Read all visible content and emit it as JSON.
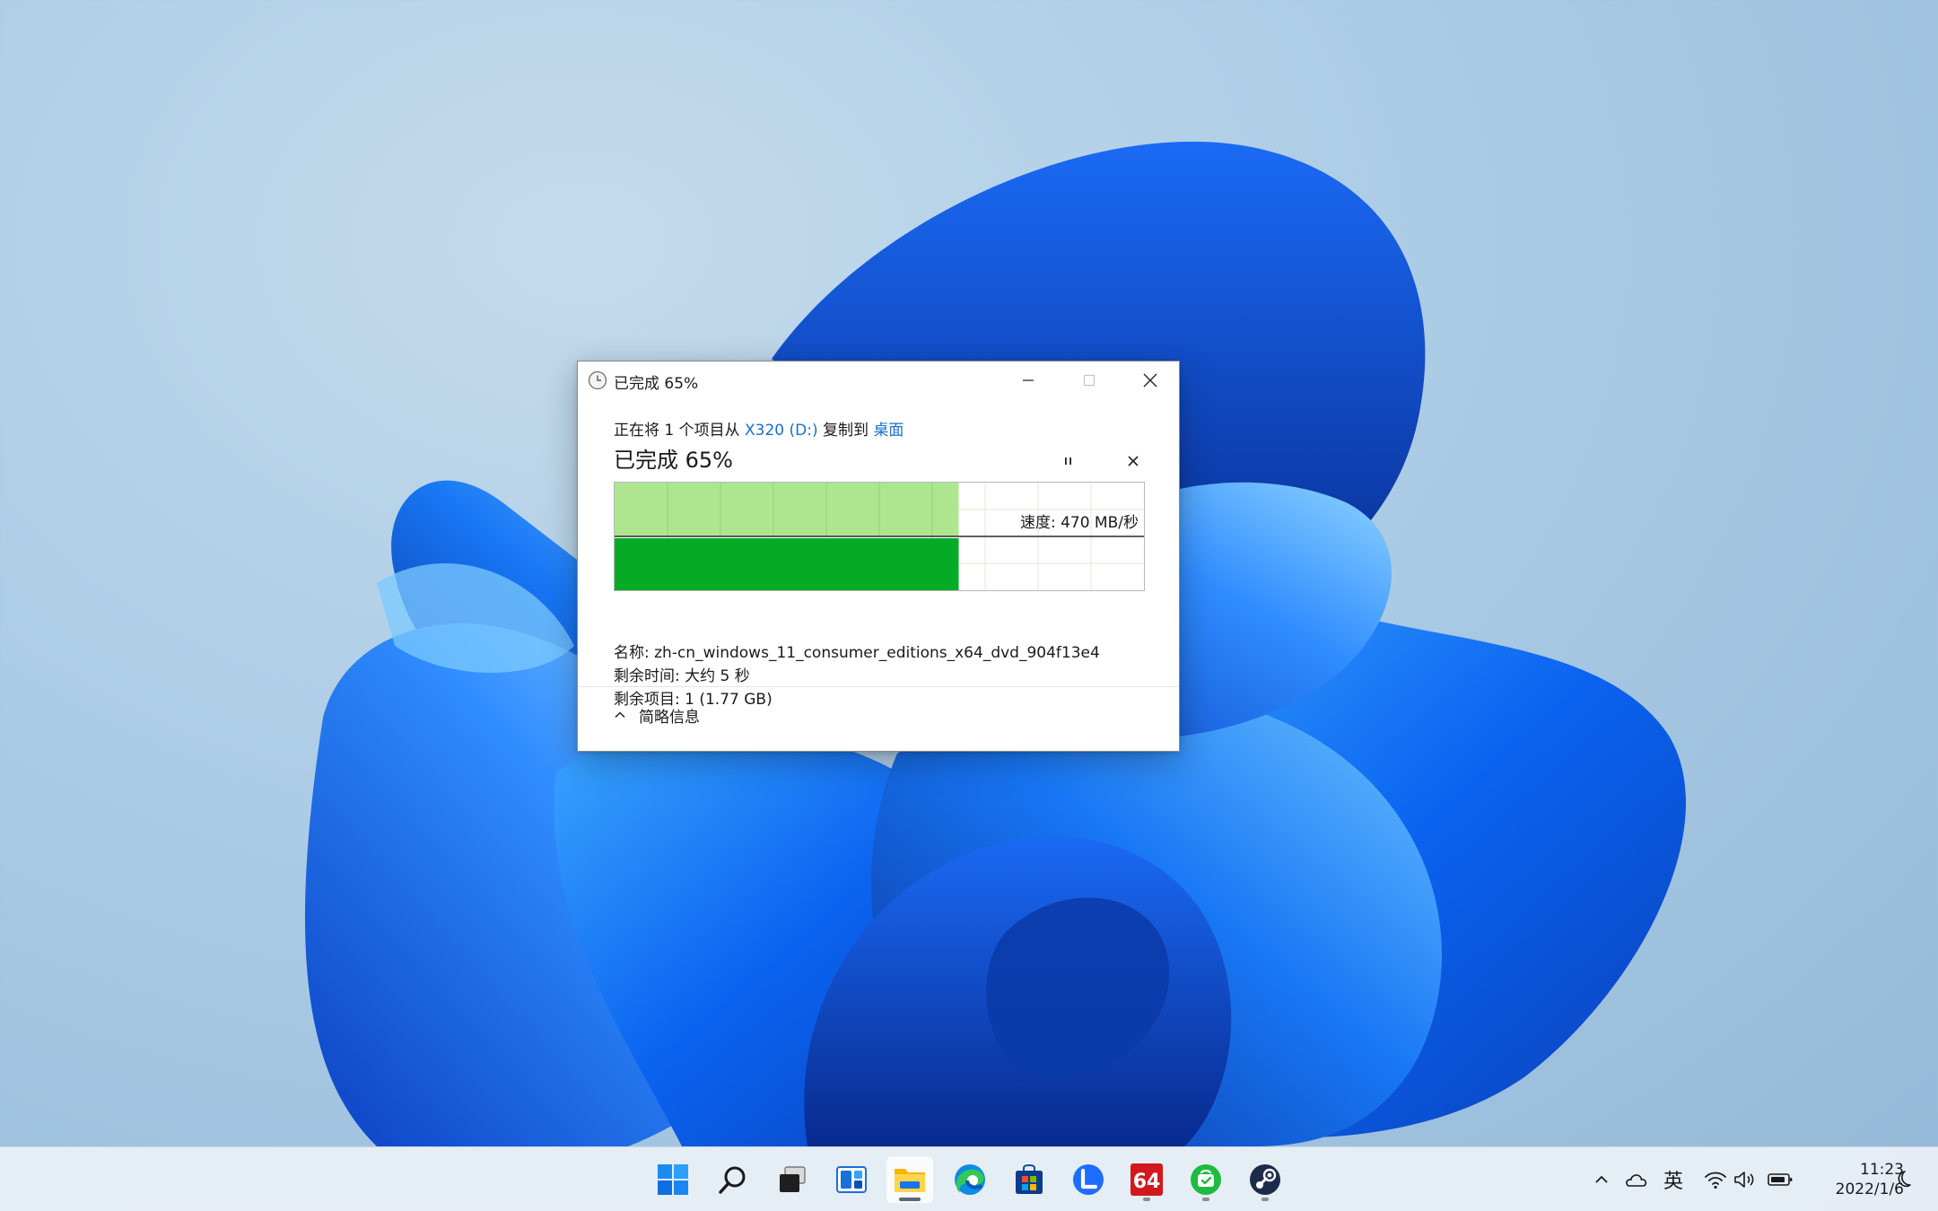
{
  "dialog": {
    "title": "已完成 65%",
    "copy_prefix": "正在将 1 个项目从 ",
    "source": "X320 (D:)",
    "copy_middle": " 复制到 ",
    "destination": "桌面",
    "status_big": "已完成 65%",
    "progress_percent": 65,
    "speed_label": "速度: 470 MB/秒",
    "name_line": "名称: zh-cn_windows_11_consumer_editions_x64_dvd_904f13e4",
    "time_line": "剩余时间: 大约 5 秒",
    "items_line": "剩余项目: 1 (1.77 GB)",
    "toggle_label": "简略信息"
  },
  "colors": {
    "progress_fill": "#06ab25",
    "speed_fill": "#aee58f",
    "link": "#1a6fc8"
  },
  "taskbar": {
    "icons": [
      "windows-start-icon",
      "search-icon",
      "task-view-icon",
      "widgets-icon",
      "file-explorer-icon",
      "edge-icon",
      "microsoft-store-icon",
      "lark-icon",
      "aida64-icon",
      "wechat-icon",
      "steam-icon"
    ],
    "ime": "英",
    "time": "11:23",
    "date": "2022/1/6",
    "icon_64_text": "64"
  }
}
